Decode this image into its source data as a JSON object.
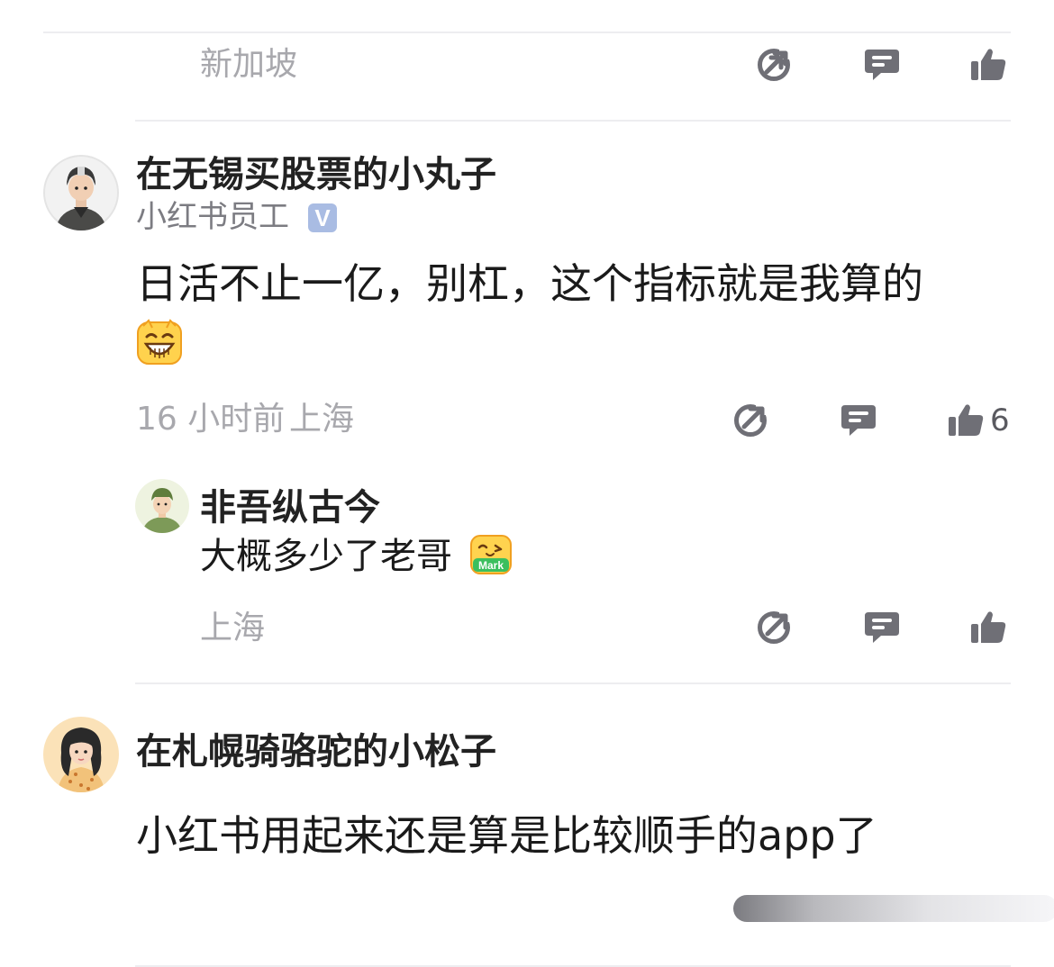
{
  "top_comment": {
    "location": "新加坡"
  },
  "comment1": {
    "username": "在无锡买股票的小丸子",
    "tag": "小红书员工",
    "verified_mark": "V",
    "text": "日活不止一亿，别杠，这个指标就是我算的",
    "emoji": "grinning-face-emoji",
    "time": "16 小时前",
    "location": "上海",
    "likes": "6"
  },
  "reply1": {
    "username": "非吾纵古今",
    "text": "大概多少了老哥",
    "emoji_label": "Mark",
    "location": "上海"
  },
  "comment2": {
    "username": "在札幌骑骆驼的小松子",
    "text": "小红书用起来还是算是比较顺手的app了"
  },
  "colors": {
    "icon": "#6f6f76",
    "meta_text": "#a8a8ad",
    "divider": "#ededf0",
    "verified_badge": "#a9bce3"
  },
  "icons": [
    "share-icon",
    "comment-icon",
    "like-icon"
  ]
}
